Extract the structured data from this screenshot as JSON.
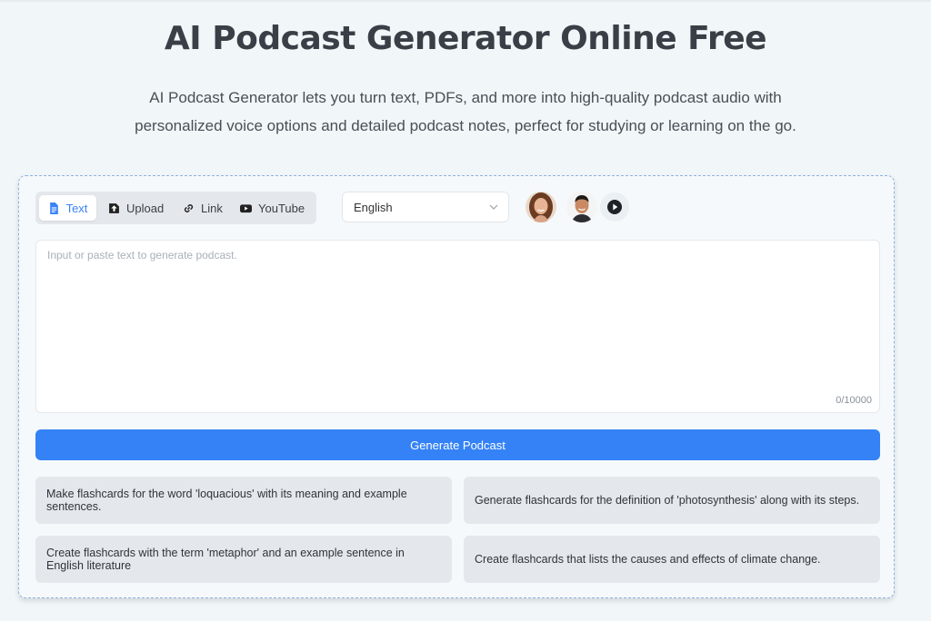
{
  "header": {
    "title": "AI Podcast Generator Online Free",
    "subtitle_line1": "AI Podcast Generator lets you turn text, PDFs, and more into high-quality podcast audio with",
    "subtitle_line2": "personalized voice options and detailed podcast notes, perfect for studying or learning on the go."
  },
  "tabs": [
    {
      "label": "Text",
      "icon": "document-icon",
      "active": true
    },
    {
      "label": "Upload",
      "icon": "upload-icon",
      "active": false
    },
    {
      "label": "Link",
      "icon": "link-icon",
      "active": false
    },
    {
      "label": "YouTube",
      "icon": "youtube-icon",
      "active": false
    }
  ],
  "language": {
    "selected": "English"
  },
  "voices": [
    {
      "name": "female-voice-avatar"
    },
    {
      "name": "male-voice-avatar"
    }
  ],
  "input": {
    "placeholder": "Input or paste text to generate podcast.",
    "value": "",
    "counter": "0/10000"
  },
  "generate_button": {
    "label": "Generate Podcast"
  },
  "suggestions": [
    "Make flashcards for the word 'loquacious' with its meaning and example sentences.",
    "Generate flashcards for the definition of 'photosynthesis' along with its steps.",
    "Create flashcards with the term 'metaphor' and an example sentence in English literature",
    "Create flashcards that lists the causes and effects of climate change."
  ],
  "colors": {
    "accent": "#3482f6",
    "background": "#f1f6f9",
    "suggestion_bg": "#e4e8ec"
  }
}
